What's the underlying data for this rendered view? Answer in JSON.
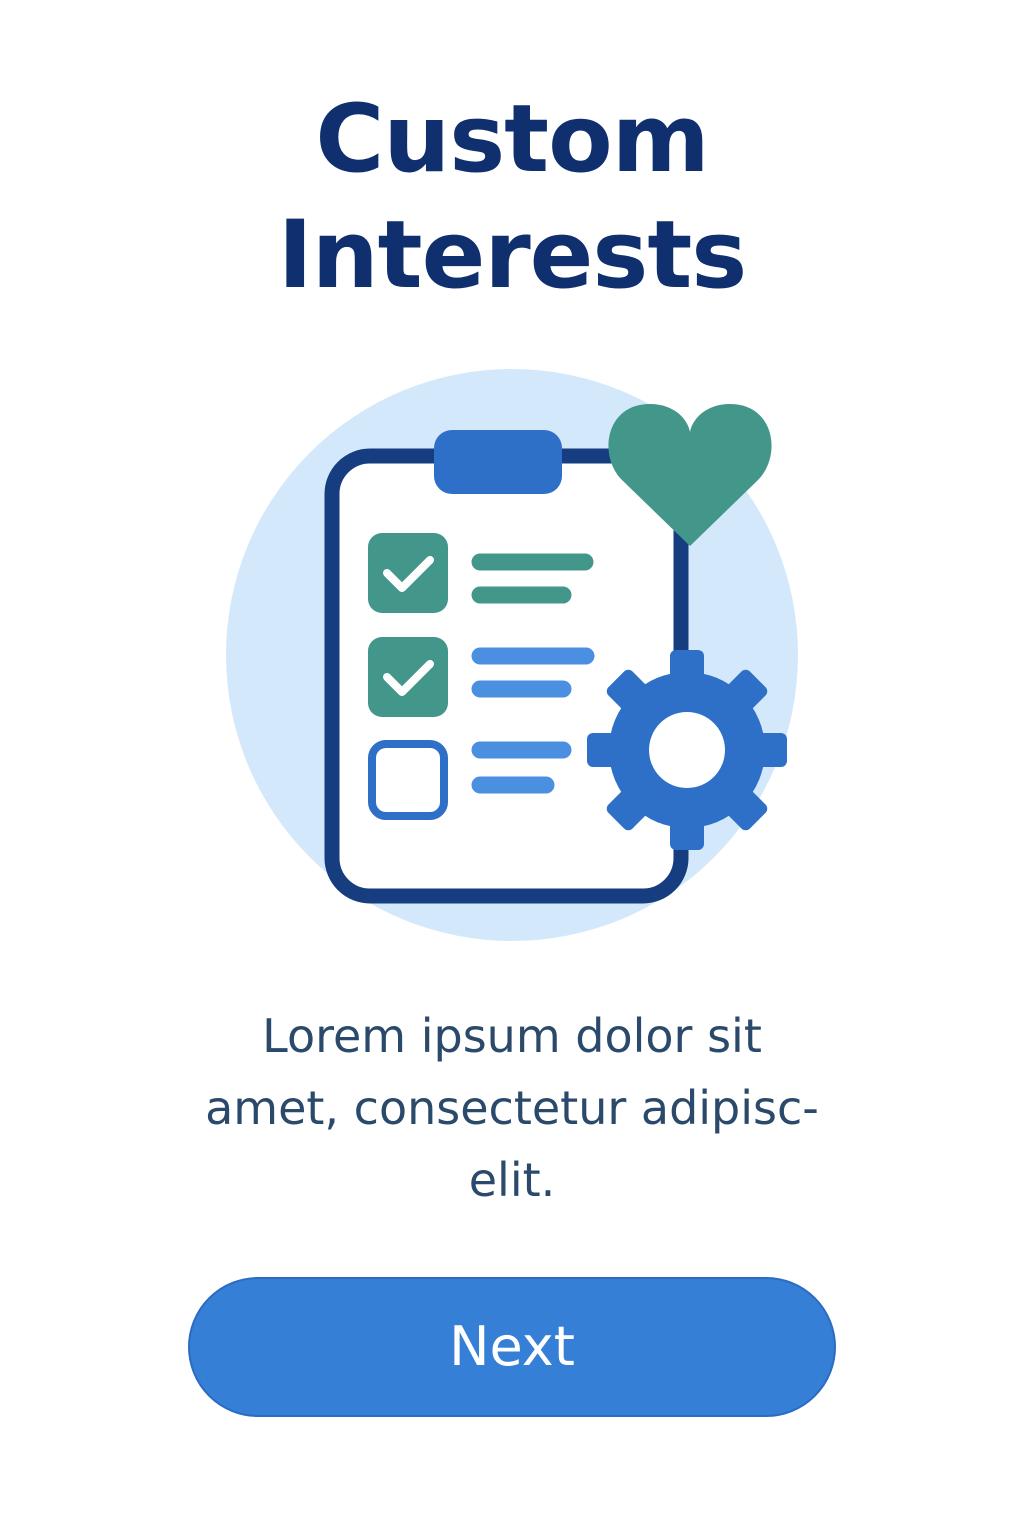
{
  "screen": {
    "title_line1": "Custom",
    "title_line2": "Interests",
    "description_line1": "Lorem ipsum dolor sit",
    "description_line2": "amet, consectetur adipisc-",
    "description_line3": "elit.",
    "next_button_label": "Next"
  },
  "illustration": {
    "icons": [
      "clipboard-icon",
      "checkbox-checked-icon",
      "checkbox-empty-icon",
      "heart-icon",
      "gear-icon"
    ],
    "checklist": [
      {
        "state": "checked"
      },
      {
        "state": "checked"
      },
      {
        "state": "unchecked"
      }
    ]
  },
  "colors": {
    "title": "#0f2f6e",
    "accent_blue": "#357fd6",
    "gear_blue": "#2e6fc7",
    "green": "#43978a",
    "circle_bg": "#d3e8fb",
    "clipboard_outline": "#153d7f",
    "body_text": "#2b4a6b"
  }
}
